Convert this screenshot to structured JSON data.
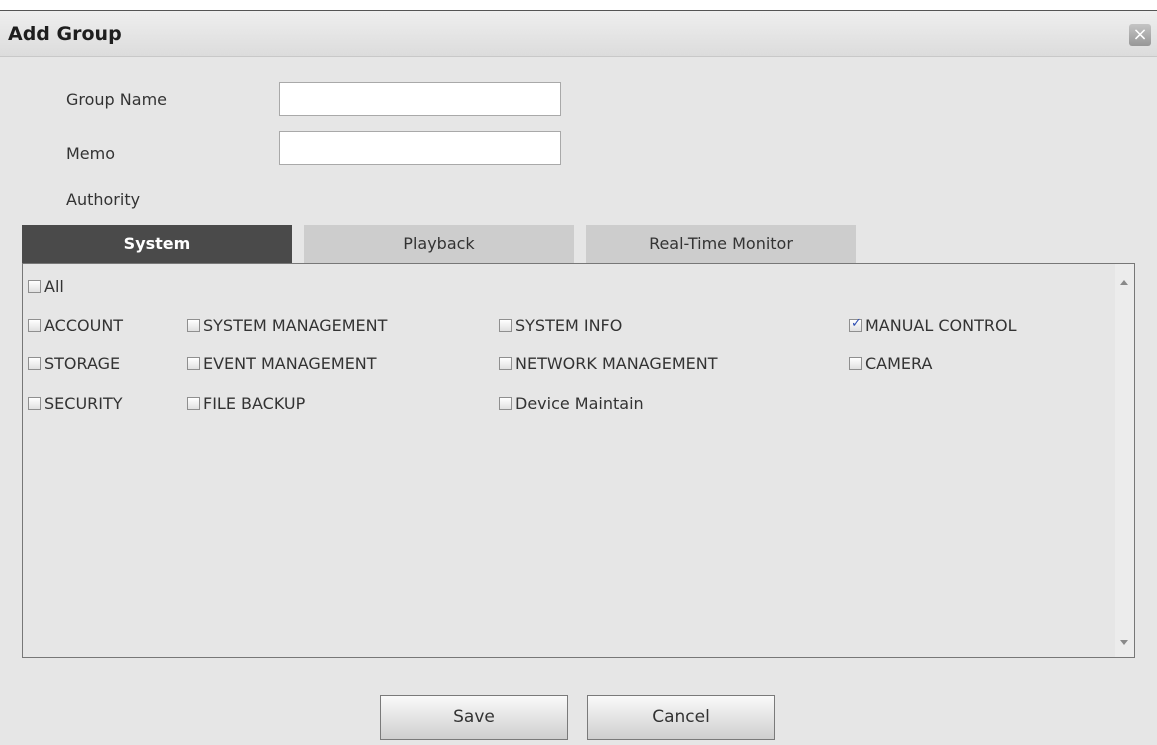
{
  "dialog": {
    "title": "Add Group",
    "close_glyph": "×"
  },
  "form": {
    "group_name_label": "Group Name",
    "group_name_value": "",
    "memo_label": "Memo",
    "memo_value": "",
    "authority_label": "Authority"
  },
  "tabs": [
    {
      "label": "System",
      "active": true
    },
    {
      "label": "Playback",
      "active": false
    },
    {
      "label": "Real-Time Monitor",
      "active": false
    }
  ],
  "permissions": {
    "all": {
      "label": "All",
      "checked": false
    },
    "items": [
      {
        "label": "ACCOUNT",
        "checked": false
      },
      {
        "label": "SYSTEM MANAGEMENT",
        "checked": false
      },
      {
        "label": "SYSTEM INFO",
        "checked": false
      },
      {
        "label": "MANUAL CONTROL",
        "checked": true
      },
      {
        "label": "STORAGE",
        "checked": false
      },
      {
        "label": "EVENT MANAGEMENT",
        "checked": false
      },
      {
        "label": "NETWORK MANAGEMENT",
        "checked": false
      },
      {
        "label": "CAMERA",
        "checked": false
      },
      {
        "label": "SECURITY",
        "checked": false
      },
      {
        "label": "FILE BACKUP",
        "checked": false
      },
      {
        "label": "Device Maintain",
        "checked": false
      }
    ]
  },
  "buttons": {
    "save": "Save",
    "cancel": "Cancel"
  },
  "icons": {
    "close": "close-icon",
    "checkbox_checked_color": "#2f4fb3",
    "active_tab_color": "#4a4a4a"
  }
}
